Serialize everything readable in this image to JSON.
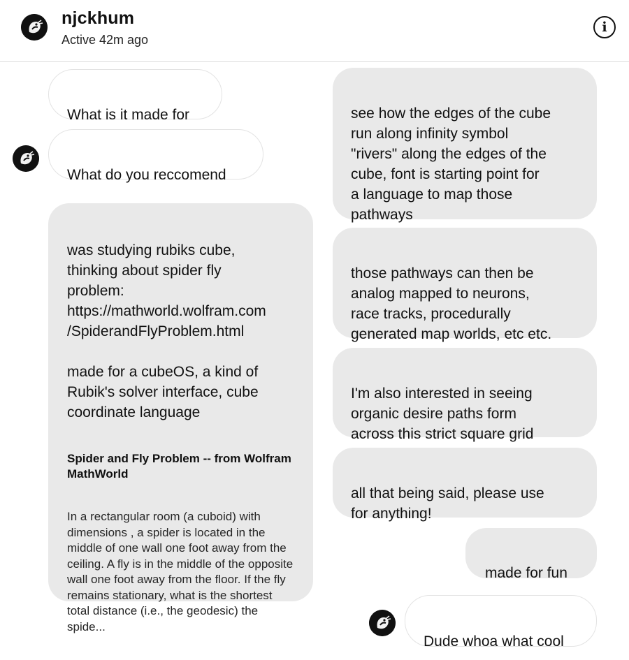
{
  "header": {
    "username": "njckhum",
    "status": "Active 42m ago",
    "avatar_icon": "avatar-icon",
    "info_icon": "info-icon"
  },
  "messages": {
    "m1": "What is it made for",
    "m2": "What do you reccomend",
    "m3": "was studying rubiks cube,\nthinking about spider fly\nproblem:\nhttps://mathworld.wolfram.com\n/SpiderandFlyProblem.html\n\nmade for a cubeOS, a kind of\nRubik's solver interface, cube\ncoordinate language",
    "link_preview": {
      "title": "Spider and Fly Problem -- from Wolfram MathWorld",
      "body": "In a rectangular room (a cuboid) with dimensions , a spider is located in the middle of one wall one foot away from the ceiling. A fly is in the middle of the opposite wall one foot away from the floor. If the fly remains stationary, what is the shortest total distance (i.e., the geodesic) the spide..."
    },
    "m4": "see how the edges of the cube\nrun along infinity symbol\n\"rivers\" along the edges of the\ncube, font is starting point for\na language to map those\npathways",
    "m5": "those pathways can then be\nanalog mapped to neurons,\nrace tracks, procedurally\ngenerated map worlds, etc etc.",
    "m6": "I'm also interested in seeing\norganic desire paths form\nacross this strict square grid",
    "m7": "all that being said, please use\nfor anything!",
    "m8": "made for fun",
    "m9": "Dude whoa what cool"
  },
  "colors": {
    "sent_bubble": "#e9e9e9",
    "received_bubble_border": "#e3e3e3",
    "text": "#111111",
    "divider": "#dbdbdb"
  }
}
